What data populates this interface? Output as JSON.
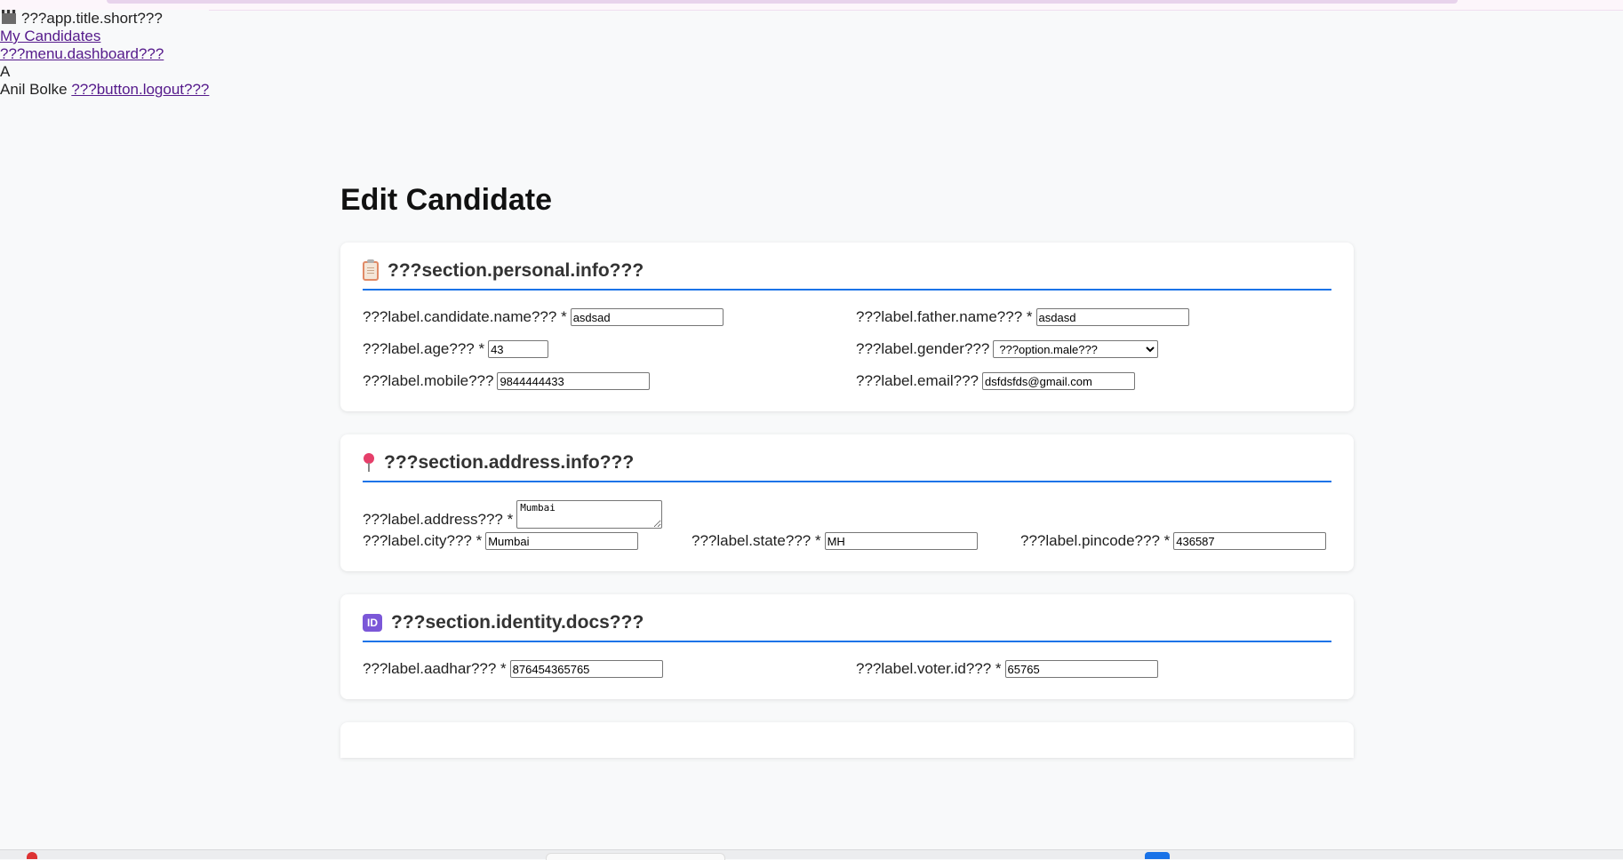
{
  "browser": {},
  "nav": {
    "app_title": "???app.title.short???",
    "my_candidates": "My Candidates",
    "dashboard": "???menu.dashboard???",
    "avatar_initial": "A",
    "user_name": "Anil Bolke",
    "logout": "???button.logout???"
  },
  "page": {
    "title": "Edit Candidate"
  },
  "personal": {
    "heading": "???section.personal.info???",
    "candidate_name_label": "???label.candidate.name??? *",
    "candidate_name_value": "asdsad",
    "father_name_label": "???label.father.name??? *",
    "father_name_value": "asdasd",
    "age_label": "???label.age??? *",
    "age_value": "43",
    "gender_label": "???label.gender???",
    "gender_value": "???option.male???",
    "mobile_label": "???label.mobile???",
    "mobile_value": "9844444433",
    "email_label": "???label.email???",
    "email_value": "dsfdsfds@gmail.com"
  },
  "address": {
    "heading": "???section.address.info???",
    "address_label": "???label.address??? *",
    "address_value": "Mumbai",
    "city_label": "???label.city??? *",
    "city_value": "Mumbai",
    "state_label": "???label.state??? *",
    "state_value": "MH",
    "pincode_label": "???label.pincode??? *",
    "pincode_value": "436587"
  },
  "identity": {
    "heading": "???section.identity.docs???",
    "aadhar_label": "???label.aadhar??? *",
    "aadhar_value": "876454365765",
    "voter_label": "???label.voter.id??? *",
    "voter_value": "65765"
  },
  "icons": {
    "app": "clapperboard-icon",
    "personal": "clipboard-icon",
    "address": "pushpin-icon",
    "identity": "id-icon"
  },
  "colors": {
    "accent": "#1a73e8",
    "link": "#551a8b",
    "background": "#f8f9fa",
    "card": "#ffffff"
  }
}
